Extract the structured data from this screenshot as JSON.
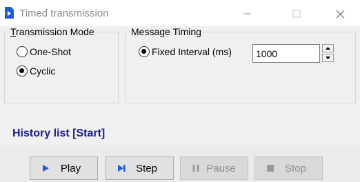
{
  "window": {
    "title": "Timed transmission"
  },
  "transmission_mode": {
    "label": "Transmission Mode",
    "options": [
      {
        "label": "One-Shot",
        "checked": false
      },
      {
        "label": "Cyclic",
        "checked": true
      }
    ]
  },
  "message_timing": {
    "label": "Message Timing",
    "option_label": "Fixed Interval (ms)",
    "interval_value": "1000"
  },
  "history": {
    "label": "History list [Start]"
  },
  "buttons": {
    "play": "Play",
    "step": "Step",
    "pause": "Pause",
    "stop": "Stop"
  },
  "colors": {
    "accent_icon": "#1f5bd6",
    "history_text": "#1a1a8a",
    "disabled_text": "#8f8f8f"
  }
}
